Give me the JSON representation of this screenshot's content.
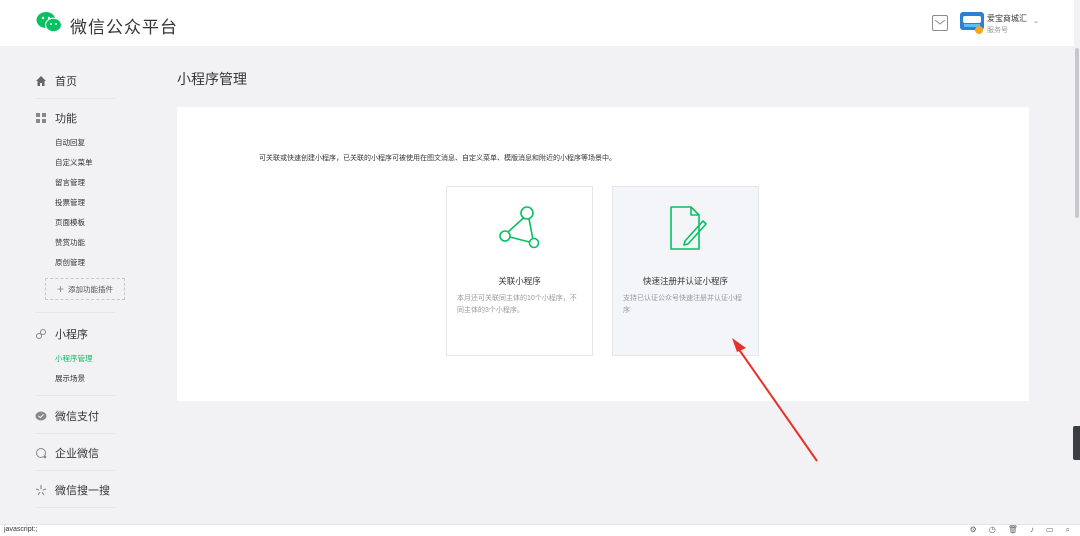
{
  "header": {
    "brand": "微信公众平台",
    "account_name": "爱宝商城汇",
    "account_type": "服务号",
    "caret": "⌄"
  },
  "sidebar": {
    "home": "首页",
    "features": "功能",
    "feature_items": [
      "自动回复",
      "自定义菜单",
      "留言管理",
      "投票管理",
      "页面模板",
      "赞赏功能",
      "原创管理"
    ],
    "add_plugin": "添加功能插件",
    "mini_program": "小程序",
    "mini_items": [
      "小程序管理",
      "展示场景"
    ],
    "wechat_pay": "微信支付",
    "work_wechat": "企业微信",
    "wechat_search": "微信搜一搜"
  },
  "main": {
    "title": "小程序管理",
    "desc": "可关联或快速创建小程序，已关联的小程序可被使用在图文消息、自定义菜单、模版消息和附近的小程序等场景中。",
    "cards": [
      {
        "title": "关联小程序",
        "desc": "本月还可关联同主体的10个小程序，不同主体的3个小程序。"
      },
      {
        "title": "快速注册并认证小程序",
        "desc": "支持已认证公众号快速注册并认证小程序"
      }
    ]
  },
  "status": {
    "text": "javascript:;"
  },
  "colors": {
    "accent": "#07c160",
    "arrow": "#e8302a"
  }
}
